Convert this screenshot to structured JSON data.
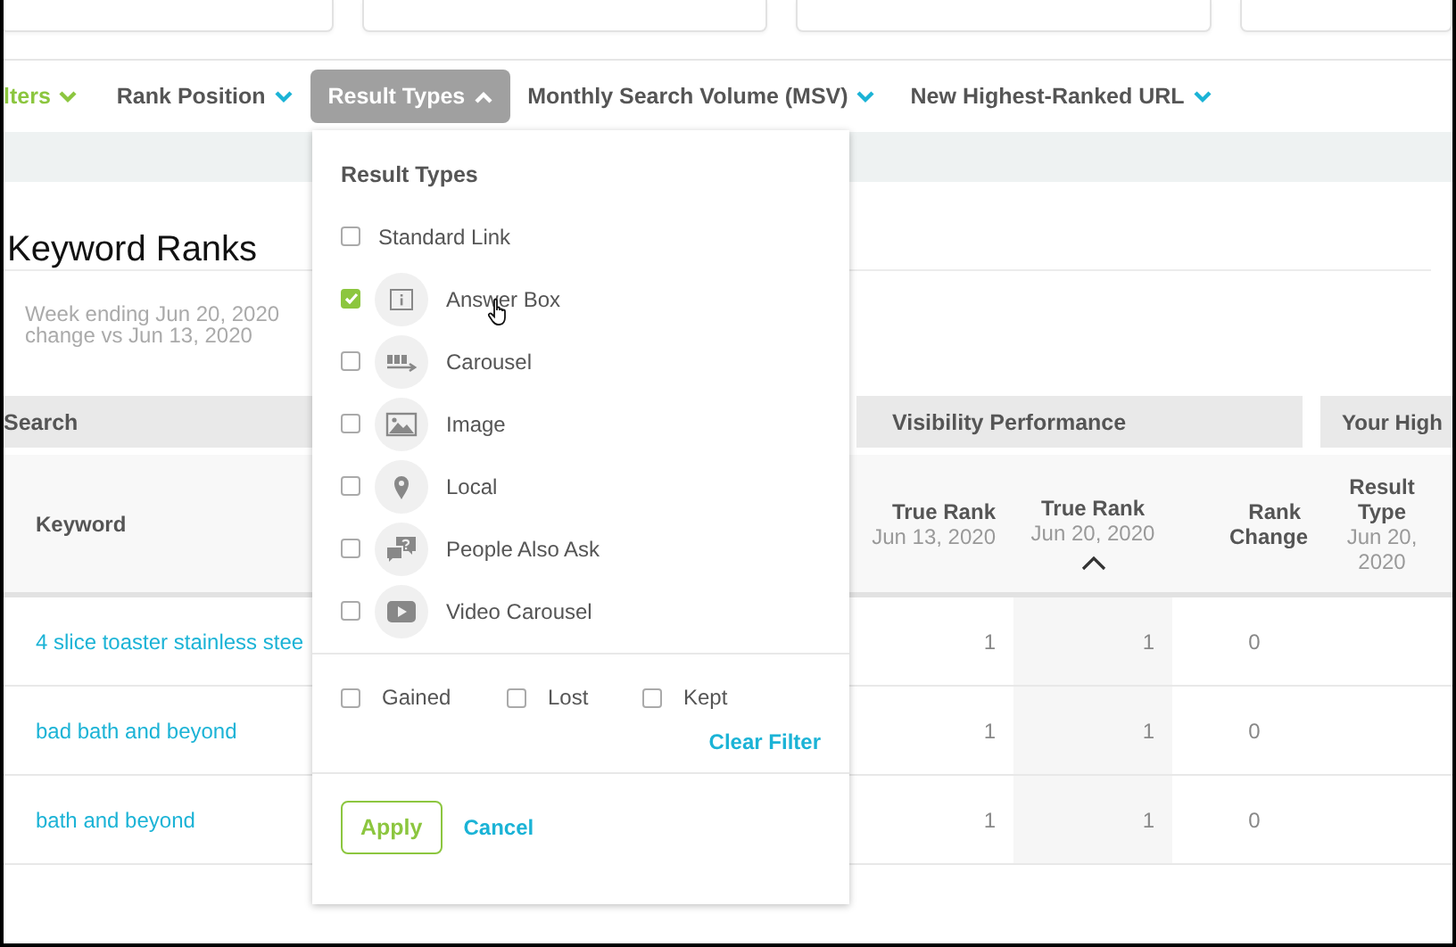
{
  "filter_bar": {
    "items": [
      {
        "label": "lters",
        "kind": "toggle",
        "selected": false
      },
      {
        "label": "Rank Position",
        "kind": "filter",
        "selected": false
      },
      {
        "label": "Result Types",
        "kind": "filter",
        "selected": true
      },
      {
        "label": "Monthly Search Volume (MSV)",
        "kind": "filter",
        "selected": false
      },
      {
        "label": "New Highest-Ranked URL",
        "kind": "filter",
        "selected": false
      }
    ]
  },
  "section": {
    "title": "Keyword Ranks",
    "period": [
      "Week ending Jun 20, 2020",
      "change vs Jun 13, 2020"
    ]
  },
  "table": {
    "groups": [
      "Search",
      "Visibility Performance",
      "Your High"
    ],
    "columns": [
      {
        "label": "Keyword",
        "sorted": false
      },
      {
        "label": "True Rank",
        "sublabel": "Jun 13, 2020",
        "sorted": false
      },
      {
        "label": "True Rank",
        "sublabel": "Jun 20, 2020",
        "sorted": true
      },
      {
        "label": "Rank Change",
        "sorted": false
      },
      {
        "label": "Result Type",
        "sublabel": "Jun 20, 2020",
        "sorted": false
      }
    ],
    "rows": [
      {
        "keyword": "4 slice toaster stainless stee",
        "values": [
          "1",
          "1",
          "0"
        ]
      },
      {
        "keyword": "bad bath and beyond",
        "values": [
          "1",
          "1",
          "0"
        ]
      },
      {
        "keyword": "bath and beyond",
        "values": [
          "1",
          "1",
          "0"
        ]
      }
    ]
  },
  "dropdown": {
    "title": "Result Types",
    "options": [
      {
        "label": "Standard Link",
        "kind": "plain",
        "checked": false
      },
      {
        "label": "Answer Box",
        "kind": "icon",
        "checked": true
      },
      {
        "label": "Carousel",
        "kind": "icon",
        "checked": false
      },
      {
        "label": "Image",
        "kind": "icon",
        "checked": false
      },
      {
        "label": "Local",
        "kind": "icon",
        "checked": false
      },
      {
        "label": "People Also Ask",
        "kind": "icon",
        "checked": false
      },
      {
        "label": "Video Carousel",
        "kind": "icon",
        "checked": false
      }
    ],
    "changes": [
      {
        "label": "Gained",
        "checked": false
      },
      {
        "label": "Lost",
        "checked": false
      },
      {
        "label": "Kept",
        "checked": false
      }
    ],
    "clear": "Clear Filter",
    "apply": "Apply",
    "cancel": "Cancel"
  }
}
